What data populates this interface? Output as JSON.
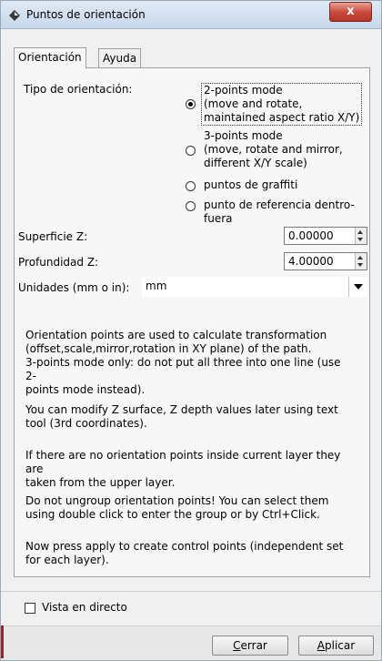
{
  "window": {
    "title": "Puntos de orientación",
    "close_label": "x"
  },
  "tabs": [
    {
      "label": "Orientación"
    },
    {
      "label": "Ayuda"
    }
  ],
  "orientation": {
    "type_label": "Tipo de orientación:",
    "options": [
      {
        "lines": [
          "2-points mode",
          "(move and rotate,",
          "maintained aspect ratio X/Y)"
        ],
        "selected": true
      },
      {
        "lines": [
          "3-points mode",
          "(move, rotate and mirror,",
          "different X/Y scale)"
        ],
        "selected": false
      },
      {
        "lines": [
          "puntos de graffiti"
        ],
        "selected": false
      },
      {
        "lines": [
          "punto de referencia dentro-fuera"
        ],
        "selected": false
      }
    ]
  },
  "surface_z": {
    "label": "Superficie Z:",
    "value": "0.00000"
  },
  "depth_z": {
    "label": "Profundidad Z:",
    "value": "4.00000"
  },
  "units": {
    "label": "Unidades (mm o in):",
    "value": "mm"
  },
  "info": [
    [
      "Orientation points are used to calculate transformation",
      "(offset,scale,mirror,rotation in XY plane) of the path.",
      "3-points mode only: do not put all three into one line (use 2-",
      "points mode instead)."
    ],
    [
      "You can modify Z surface, Z depth values later using text",
      "tool (3rd coordinates)."
    ],
    [
      "If there are no orientation points inside current layer they are",
      "taken from the upper layer."
    ],
    [
      "Do not ungroup orientation points! You can select them",
      "using double click to enter the group or by Ctrl+Click."
    ],
    [
      "Now press apply to create control points (independent set",
      "for each layer)."
    ]
  ],
  "live_preview": {
    "label": "Vista en directo",
    "checked": false
  },
  "buttons": {
    "close": "Cerrar",
    "apply": "Aplicar"
  }
}
